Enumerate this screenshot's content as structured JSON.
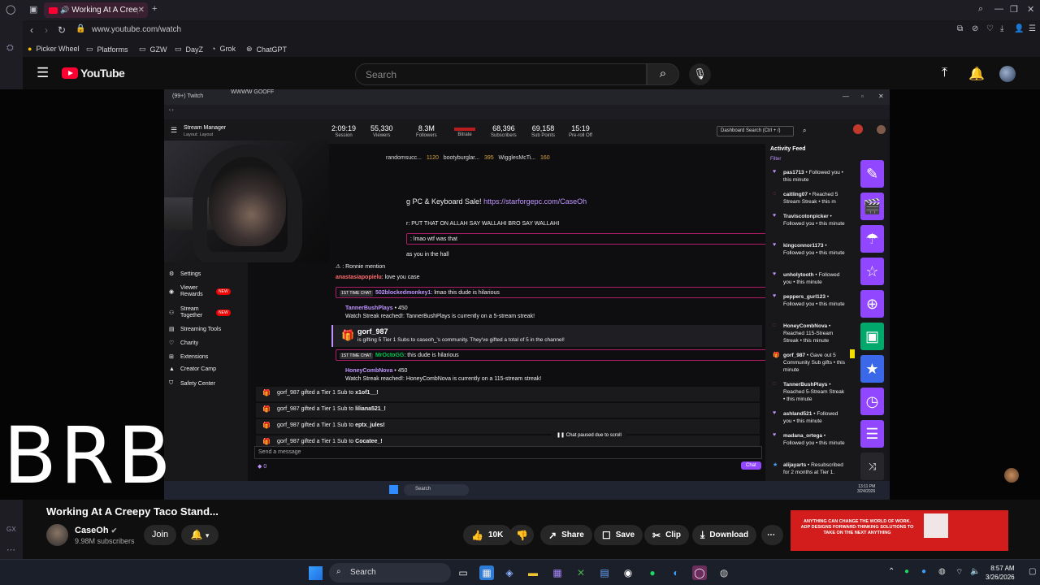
{
  "browser": {
    "tab_title": "Working At A Creepy T",
    "url": "www.youtube.com/watch",
    "bookmarks": [
      "Picker Wheel",
      "Platforms",
      "GZW",
      "DayZ",
      "Grok",
      "ChatGPT"
    ]
  },
  "youtube": {
    "logo": "YouTube",
    "search_placeholder": "Search"
  },
  "stream_screen": {
    "tab_text": "(99+) Twitch",
    "tab_text2": "WWWW GOOFF",
    "stream_manager": "Stream Manager",
    "layout_text": "Layout: Layout",
    "stats": [
      {
        "value": "2:09:19",
        "label": "Session"
      },
      {
        "value": "55,330",
        "label": "Viewers"
      },
      {
        "value": "8.3M",
        "label": "Followers"
      },
      {
        "value": "",
        "label": "Bitrate"
      },
      {
        "value": "68,396",
        "label": "Subscribers"
      },
      {
        "value": "69,158",
        "label": "Sub Points"
      },
      {
        "value": "15:19",
        "label": "Pre-roll Off"
      }
    ],
    "dashboard_search": "Dashboard Search (Ctrl + /)",
    "nav": [
      {
        "label": "Settings",
        "badge": ""
      },
      {
        "label": "Viewer Rewards",
        "badge": "NEW"
      },
      {
        "label": "Stream Together",
        "badge": "NEW"
      },
      {
        "label": "Streaming Tools",
        "badge": ""
      },
      {
        "label": "Charity",
        "badge": ""
      },
      {
        "label": "Extensions",
        "badge": ""
      },
      {
        "label": "Creator Camp",
        "badge": ""
      },
      {
        "label": "Safety Center",
        "badge": ""
      }
    ],
    "pinned": [
      "randomsucc...",
      "1120",
      "bootyburglar...",
      "395",
      "WigglesMcTi...",
      "160"
    ],
    "promo_prefix": "g PC & Keyboard Sale!",
    "promo_link": "https://starforgepc.com/CaseOh",
    "chat": [
      {
        "name": "",
        "text": "r: PUT THAT ON ALLAH SAY WALLAHI BRO SAY WALLAHI"
      },
      {
        "name": "",
        "text": ": lmao wtf was that"
      },
      {
        "name": "",
        "text": "as you in the hall"
      },
      {
        "name": "",
        "text": ": Ronnie mention"
      },
      {
        "name": "anastasiapopielu",
        "text": ": love you case"
      },
      {
        "name": "502blockedmonkey1",
        "text": ": lmao this dude is hilarious",
        "tag": "1ST TIME CHAT"
      },
      {
        "name": "TannerBushPlays",
        "text": "• 450"
      },
      {
        "name": "",
        "text": "Watch Streak reached!: TannerBushPlays is currently on a 5-stream streak!"
      },
      {
        "name": "gorf_987",
        "text": "is gifting 5 Tier 1 Subs to caseoh_'s community. They've gifted a total of 5 in the channel!"
      },
      {
        "name": "MrOctoGG",
        "text": ": this dude is hilarious",
        "tag": "1ST TIME CHAT"
      },
      {
        "name": "HoneyCombNova",
        "text": "• 450"
      },
      {
        "name": "",
        "text": "Watch Streak reached!: HoneyCombNova is currently on a 115-stream streak!"
      }
    ],
    "gifts": [
      {
        "text": "gorf_987 gifted a Tier 1 Sub to",
        "to": "x1of1__!"
      },
      {
        "text": "gorf_987 gifted a Tier 1 Sub to",
        "to": "liliana521_!"
      },
      {
        "text": "gorf_987 gifted a Tier 1 Sub to",
        "to": "eptx_jules!"
      },
      {
        "text": "gorf_987 gifted a Tier 1 Sub to",
        "to": "Cocatee_!"
      }
    ],
    "paused": "Chat paused due to scroll",
    "send_placeholder": "Send a message",
    "chat_button": "Chat",
    "activity_head": "Activity Feed",
    "filter": "Filter",
    "activity": [
      {
        "name": "pas1713",
        "text": "• Followed you • this minute"
      },
      {
        "name": "caitling07",
        "text": "• Reached 5 Stream Streak • this m"
      },
      {
        "name": "Traviscotonpicker",
        "text": "• Followed you • this minute"
      },
      {
        "name": "kingconnor1173",
        "text": "• Followed you • this minute"
      },
      {
        "name": "unholytooth",
        "text": "• Followed you • this minute"
      },
      {
        "name": "peppers_gurl123",
        "text": "• Followed you • this minute"
      },
      {
        "name": "HoneyCombNova",
        "text": "• Reached 115-Stream Streak • this minute"
      },
      {
        "name": "gorf_987",
        "text": "• Gave out 5 Community Sub gifts • this minute"
      },
      {
        "name": "TannerBushPlays",
        "text": "• Reached 5-Stream Streak • this minute"
      },
      {
        "name": "ashland521",
        "text": "• Followed you • this minute"
      },
      {
        "name": "madana_ortega",
        "text": "• Followed you • this minute"
      },
      {
        "name": "alijayarts",
        "text": "• Resubscribed for 2 months at Tier 1."
      }
    ],
    "win_search": "Search",
    "win_time": "13:11 PM",
    "win_date": "3/24/2026"
  },
  "overlay": {
    "brb": "BRB"
  },
  "video": {
    "title": "Working At A Creepy Taco Stand...",
    "channel": "CaseOh",
    "subscribers": "9.98M subscribers",
    "join": "Join",
    "likes": "10K",
    "share": "Share",
    "save": "Save",
    "clip": "Clip",
    "download": "Download"
  },
  "ad": {
    "text": "ANYTHING CAN CHANGE THE WORLD OF WORK. ADP DESIGNS FORWARD-THINKING SOLUTIONS TO TAKE ON THE NEXT ANYTHING"
  },
  "taskbar": {
    "search": "Search",
    "time": "8:57 AM",
    "date": "3/26/2026"
  },
  "colors": {
    "youtube_red": "#ff0033",
    "twitch_purple": "#9146ff",
    "ad_red": "#d31c1c"
  }
}
